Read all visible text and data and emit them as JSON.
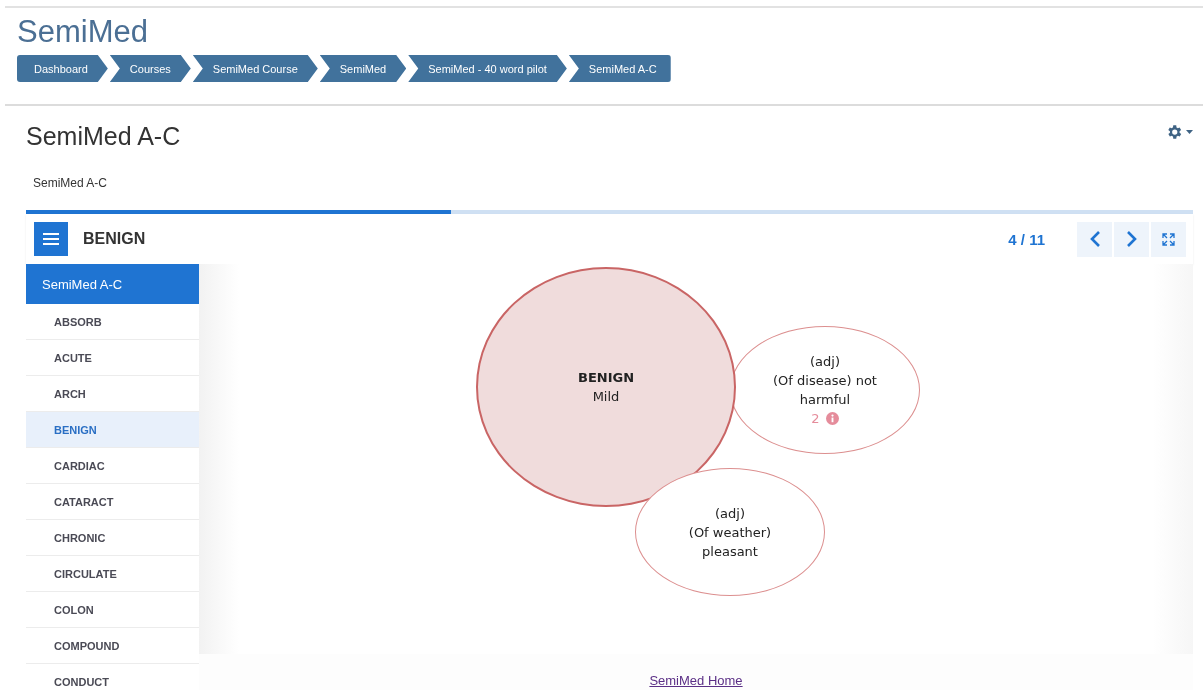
{
  "site_title": "SemiMed",
  "breadcrumbs": [
    "Dashboard",
    "Courses",
    "SemiMed Course",
    "SemiMed",
    "SemiMed - 40 word pilot",
    "SemiMed A-C"
  ],
  "page_heading": "SemiMed A-C",
  "description": "SemiMed A-C",
  "player": {
    "progress": {
      "level": 0.364
    },
    "title": "BENIGN",
    "counter": "4 / 11",
    "sidebar": {
      "heading": "SemiMed A-C",
      "items": [
        {
          "label": "ABSORB",
          "selected": false
        },
        {
          "label": "ACUTE",
          "selected": false
        },
        {
          "label": "ARCH",
          "selected": false
        },
        {
          "label": "BENIGN",
          "selected": true
        },
        {
          "label": "CARDIAC",
          "selected": false
        },
        {
          "label": "CATARACT",
          "selected": false
        },
        {
          "label": "CHRONIC",
          "selected": false
        },
        {
          "label": "CIRCULATE",
          "selected": false
        },
        {
          "label": "COLON",
          "selected": false
        },
        {
          "label": "COMPOUND",
          "selected": false
        },
        {
          "label": "CONDUCT",
          "selected": false
        }
      ]
    },
    "diagram": {
      "nodes": [
        {
          "kind": "main",
          "word": "BENIGN",
          "lines": [
            "Mild"
          ]
        },
        {
          "kind": "sense",
          "lines": [
            "(adj)",
            "(Of disease) not harmful"
          ],
          "count": "2"
        },
        {
          "kind": "sense",
          "lines": [
            "(adj)",
            "(Of weather) pleasant"
          ]
        }
      ]
    },
    "footer_link": "SemiMed Home"
  }
}
